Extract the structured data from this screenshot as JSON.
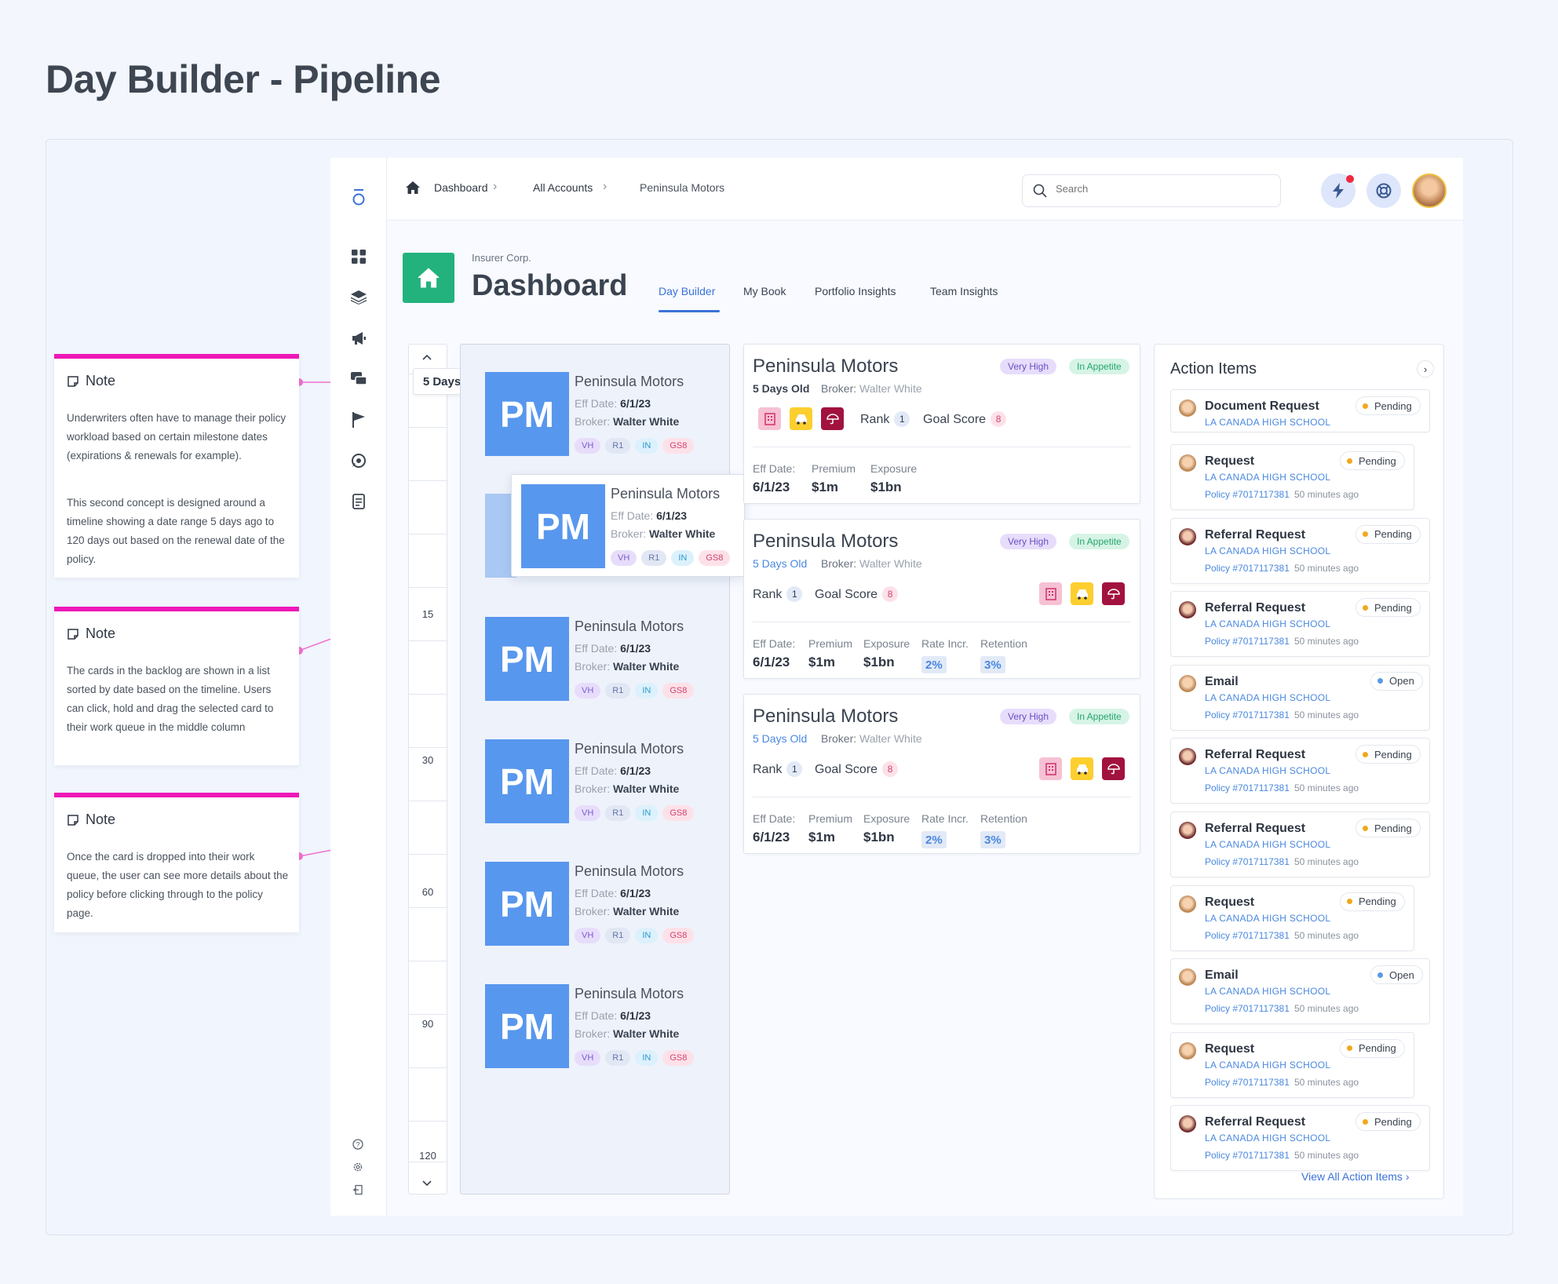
{
  "page": {
    "title": "Day Builder - Pipeline"
  },
  "breadcrumb": {
    "items": [
      "Dashboard",
      "All Accounts",
      "Peninsula Motors"
    ]
  },
  "search": {
    "placeholder": "Search"
  },
  "header": {
    "org": "Insurer Corp.",
    "title": "Dashboard"
  },
  "tabs": [
    {
      "label": "Day Builder",
      "active": true
    },
    {
      "label": "My Book",
      "active": false
    },
    {
      "label": "Portfolio Insights",
      "active": false
    },
    {
      "label": "Team Insights",
      "active": false
    }
  ],
  "timeline": {
    "current": "5 Days",
    "labels": [
      "15",
      "30",
      "60",
      "90",
      "120"
    ]
  },
  "backlog_card": {
    "initials": "PM",
    "name": "Peninsula Motors",
    "eff_label": "Eff Date:",
    "eff_value": "6/1/23",
    "broker_label": "Broker:",
    "broker_value": "Walter White",
    "chips": [
      "VH",
      "R1",
      "IN",
      "GS8"
    ]
  },
  "queue": {
    "name": "Peninsula Motors",
    "age": "5 Days Old",
    "broker_label": "Broker:",
    "broker_value": "Walter White",
    "priority": "Very High",
    "appetite": "In Appetite",
    "rank_label": "Rank",
    "rank": "1",
    "goal_label": "Goal Score",
    "goal": "8",
    "metrics": {
      "eff_label": "Eff Date:",
      "eff": "6/1/23",
      "premium_label": "Premium",
      "premium": "$1m",
      "exposure_label": "Exposure",
      "exposure": "$1bn",
      "rate_label": "Rate Incr.",
      "rate": "2%",
      "retention_label": "Retention",
      "retention": "3%"
    }
  },
  "actions": {
    "title": "Action Items",
    "view_all": "View All Action Items",
    "subtitle": "LA CANADA HIGH SCHOOL",
    "policy": "Policy #7017117381",
    "time": "50 minutes ago",
    "items": [
      {
        "title": "Document Request",
        "status": "Pending",
        "avatar": "yellow"
      },
      {
        "title": "Request",
        "status": "Pending",
        "avatar": "yellow"
      },
      {
        "title": "Referral Request",
        "status": "Pending",
        "avatar": "red"
      },
      {
        "title": "Referral Request",
        "status": "Pending",
        "avatar": "red"
      },
      {
        "title": "Email",
        "status": "Open",
        "avatar": "yellow"
      },
      {
        "title": "Referral Request",
        "status": "Pending",
        "avatar": "red"
      },
      {
        "title": "Referral Request",
        "status": "Pending",
        "avatar": "red"
      },
      {
        "title": "Request",
        "status": "Pending",
        "avatar": "yellow"
      },
      {
        "title": "Email",
        "status": "Open",
        "avatar": "yellow"
      },
      {
        "title": "Request",
        "status": "Pending",
        "avatar": "yellow"
      },
      {
        "title": "Referral Request",
        "status": "Pending",
        "avatar": "red"
      }
    ]
  },
  "notes": [
    {
      "title": "Note",
      "paragraphs": [
        "Underwriters often have to manage their policy workload based on certain milestone dates (expirations & renewals for example).",
        "This second concept is designed around a timeline showing a date range 5 days ago to 120 days out based on the renewal date of the policy."
      ]
    },
    {
      "title": "Note",
      "paragraphs": [
        "The cards in the backlog are shown in a list sorted by date based on the timeline. Users can click, hold and drag the selected card to their work queue in the middle column"
      ]
    },
    {
      "title": "Note",
      "paragraphs": [
        "Once the card is dropped into their work queue, the user can see more details about the policy before clicking through to the policy page."
      ]
    }
  ],
  "colors": {
    "accent": "#3b72d9",
    "note": "#ee18b8",
    "home_tile": "#23b27d",
    "pm_tile": "#5897ee"
  }
}
